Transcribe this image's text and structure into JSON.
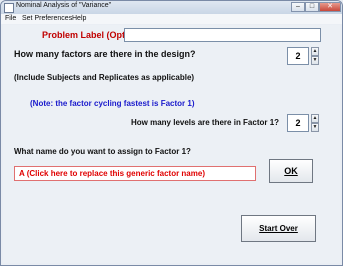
{
  "window": {
    "title": "Nominal Analysis of \"Variance\""
  },
  "menu": {
    "items": [
      "File",
      "Set Preferences",
      "Help"
    ]
  },
  "form": {
    "problem_label": "Problem Label (Optional):",
    "problem_label_value": "",
    "factors_question": "How many factors are there in the design?",
    "factors_value": "2",
    "include_note": "(Include Subjects and Replicates as applicable)",
    "cycling_note": "(Note:  the factor cycling fastest is Factor 1)",
    "levels_question": "How many levels are there in Factor 1?",
    "levels_value": "2",
    "name_question": "What name do you want to assign to Factor 1?",
    "factor_name": "A   (Click here to replace this generic factor name)"
  },
  "buttons": {
    "ok": "OK",
    "start_over": "Start Over"
  },
  "colors": {
    "label_red": "#c00000",
    "note_blue": "#1a1acc",
    "factor_text": "#e00000"
  }
}
